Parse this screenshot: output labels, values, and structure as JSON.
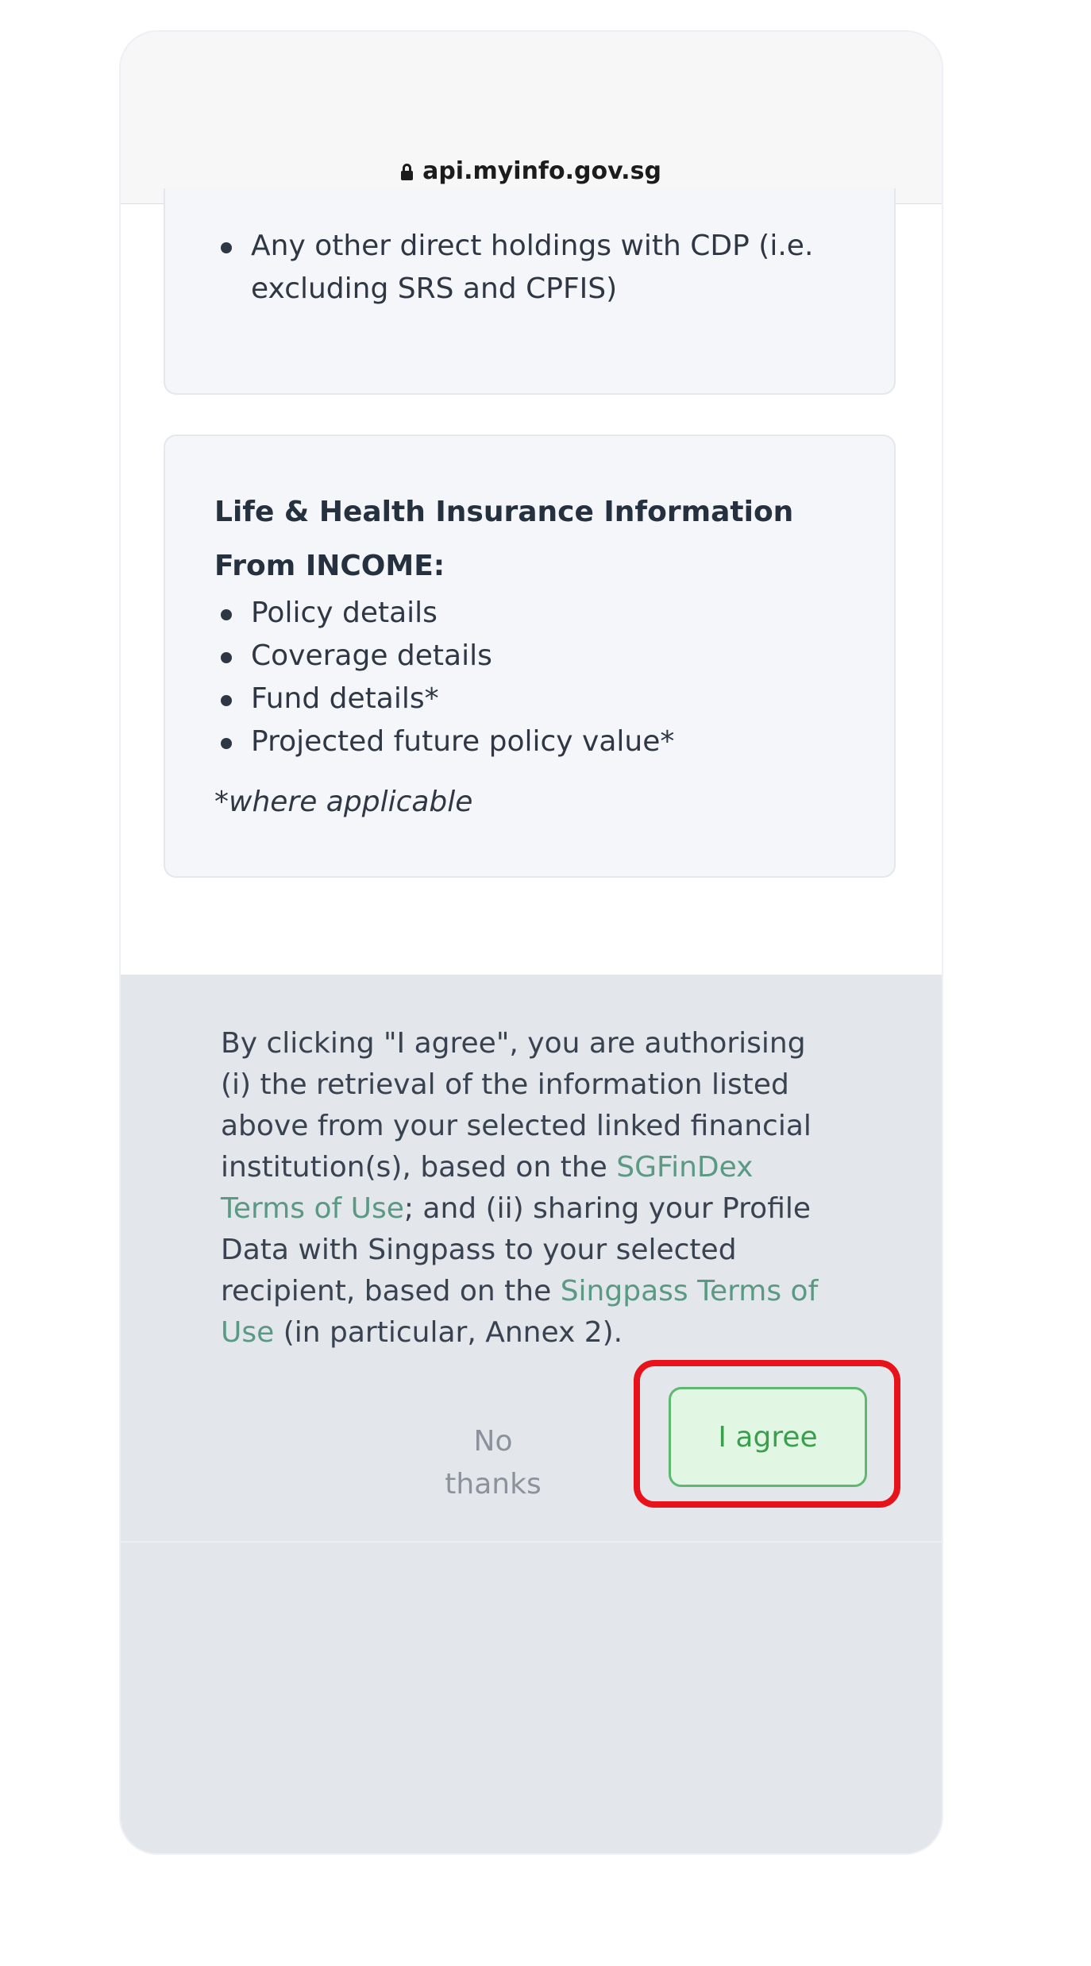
{
  "browser": {
    "url": "api.myinfo.gov.sg"
  },
  "card1": {
    "items": [
      "Any other direct holdings with CDP (i.e. excluding SRS and CPFIS)"
    ]
  },
  "card2": {
    "title_line1": "Life & Health Insurance Information",
    "title_line2": "From INCOME:",
    "items": [
      "Policy details",
      "Coverage details",
      "Fund details*",
      "Projected future policy value*"
    ],
    "note": "*where applicable"
  },
  "consent": {
    "part1": "By clicking \"I agree\", you are authorising (i) the retrieval of the information listed above from your selected linked financial institution(s), based on the ",
    "link1": "SGFinDex Terms of Use",
    "part2": "; and (ii) sharing your Profile Data with Singpass to your selected recipient, based on the ",
    "link2": "Singpass Terms of Use",
    "part3": " (in particular, Annex 2)."
  },
  "actions": {
    "no_thanks": "No thanks",
    "agree": "I agree"
  },
  "colors": {
    "highlight": "#e8121a",
    "agree_border": "#5fb870",
    "link": "#5a9a82"
  }
}
